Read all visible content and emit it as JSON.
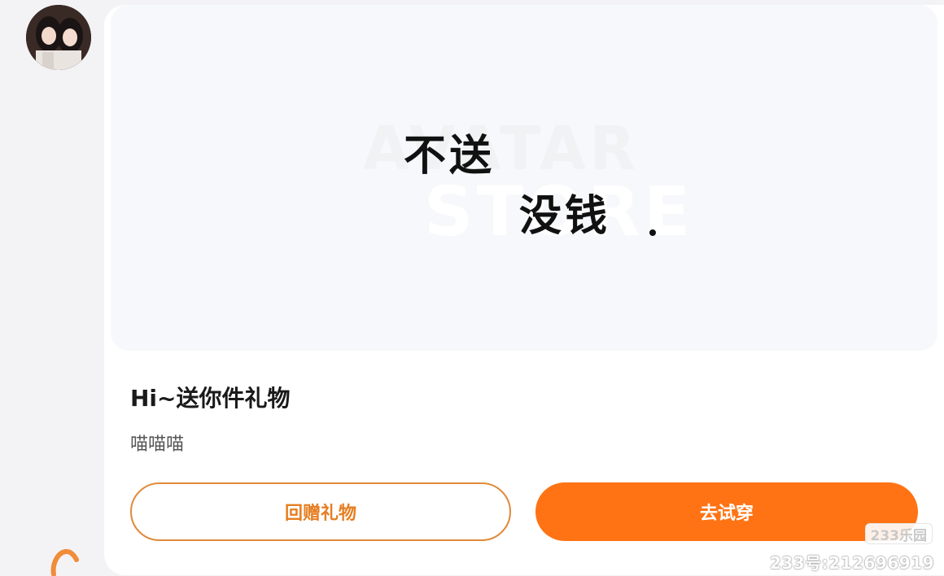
{
  "gift": {
    "title": "Hi~送你件礼物",
    "subtitle": "喵喵喵"
  },
  "preview": {
    "watermark_line1": "AVATAR",
    "watermark_line2": "STORE",
    "sticker_line1": "不送",
    "sticker_line2": "没钱"
  },
  "actions": {
    "return_gift_label": "回赠礼物",
    "try_on_label": "去试穿"
  },
  "footer": {
    "logo_text": "233乐园",
    "account_id": "233号:212696919"
  },
  "colors": {
    "accent": "#ff7314",
    "outline_accent": "#e08a3c"
  }
}
